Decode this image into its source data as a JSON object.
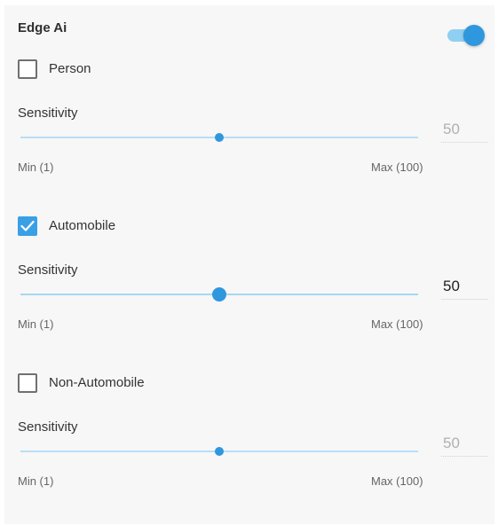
{
  "header": {
    "title": "Edge Ai",
    "toggle_on": true
  },
  "sections": [
    {
      "label": "Person",
      "checked": false,
      "sensitivity_label": "Sensitivity",
      "value": "50",
      "level": 0.5,
      "min_label": "Min (1)",
      "max_label": "Max (100)"
    },
    {
      "label": "Automobile",
      "checked": true,
      "sensitivity_label": "Sensitivity",
      "value": "50",
      "level": 0.5,
      "min_label": "Min (1)",
      "max_label": "Max (100)"
    },
    {
      "label": "Non-Automobile",
      "checked": false,
      "sensitivity_label": "Sensitivity",
      "value": "50",
      "level": 0.5,
      "min_label": "Min (1)",
      "max_label": "Max (100)"
    }
  ],
  "colors": {
    "accent": "#2f97de",
    "checkbox_checked": "#3aa0e6",
    "track": "#b9def5",
    "panel_bg": "#f7f7f7"
  }
}
